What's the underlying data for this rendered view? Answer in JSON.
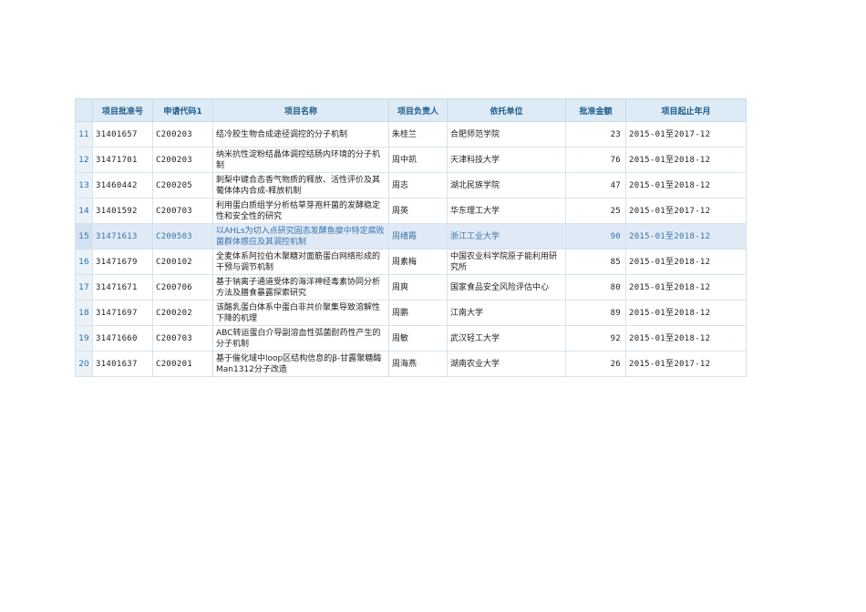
{
  "table": {
    "headers": [
      "",
      "项目批准号",
      "申请代码1",
      "项目名称",
      "项目负责人",
      "依托单位",
      "批准金额",
      "项目起止年月"
    ],
    "rows": [
      {
        "idx": "11",
        "id": "31401657",
        "code": "C200203",
        "name": "结冷胶生物合成途径调控的分子机制",
        "leader": "朱桂兰",
        "org": "合肥师范学院",
        "amount": "23",
        "period": "2015-01至2017-12"
      },
      {
        "idx": "12",
        "id": "31471701",
        "code": "C200203",
        "name": "纳米抗性淀粉结晶体调控结肠内环境的分子机制",
        "leader": "周中凯",
        "org": "天津科技大学",
        "amount": "76",
        "period": "2015-01至2018-12"
      },
      {
        "idx": "13",
        "id": "31460442",
        "code": "C200205",
        "name": "刺梨中键合态香气物质的释放、活性评价及其葡体体内合成-释放机制",
        "leader": "周志",
        "org": "湖北民族学院",
        "amount": "47",
        "period": "2015-01至2018-12"
      },
      {
        "idx": "14",
        "id": "31401592",
        "code": "C200703",
        "name": "利用蛋白质组学分析枯草芽孢杆菌的发酵稳定性和安全性的研究",
        "leader": "周英",
        "org": "华东理工大学",
        "amount": "25",
        "period": "2015-01至2017-12"
      },
      {
        "idx": "15",
        "id": "31471613",
        "code": "C200503",
        "name": "以AHLs为切入点研究固态发酵鱼糜中特定腐败菌群体感应及其调控机制",
        "leader": "周绪霞",
        "org": "浙江工业大学",
        "amount": "90",
        "period": "2015-01至2018-12",
        "highlight": true
      },
      {
        "idx": "16",
        "id": "31471679",
        "code": "C200102",
        "name": "全麦体系阿拉伯木聚糖对面筋蛋白网络形成的干预与调节机制",
        "leader": "周素梅",
        "org": "中国农业科学院原子能利用研究所",
        "amount": "85",
        "period": "2015-01至2018-12"
      },
      {
        "idx": "17",
        "id": "31471671",
        "code": "C200706",
        "name": "基于钠离子通道受体的海洋神经毒素协同分析方法及膳食暴露探索研究",
        "leader": "周爽",
        "org": "国家食品安全风险评估中心",
        "amount": "80",
        "period": "2015-01至2018-12"
      },
      {
        "idx": "18",
        "id": "31471697",
        "code": "C200202",
        "name": "该酪乳蛋白体系中蛋白非共价聚集导致溶解性下降的机理",
        "leader": "周鹏",
        "org": "江南大学",
        "amount": "89",
        "period": "2015-01至2018-12"
      },
      {
        "idx": "19",
        "id": "31471660",
        "code": "C200703",
        "name": "ABC转运蛋白介导副溶血性弧菌耐药性产生的分子机制",
        "leader": "周敏",
        "org": "武汉轻工大学",
        "amount": "92",
        "period": "2015-01至2018-12"
      },
      {
        "idx": "20",
        "id": "31401637",
        "code": "C200201",
        "name": "基于催化域中loop区结构信息的β-甘露聚糖酶Man1312分子改造",
        "leader": "周海燕",
        "org": "湖南农业大学",
        "amount": "26",
        "period": "2015-01至2017-12"
      }
    ]
  }
}
